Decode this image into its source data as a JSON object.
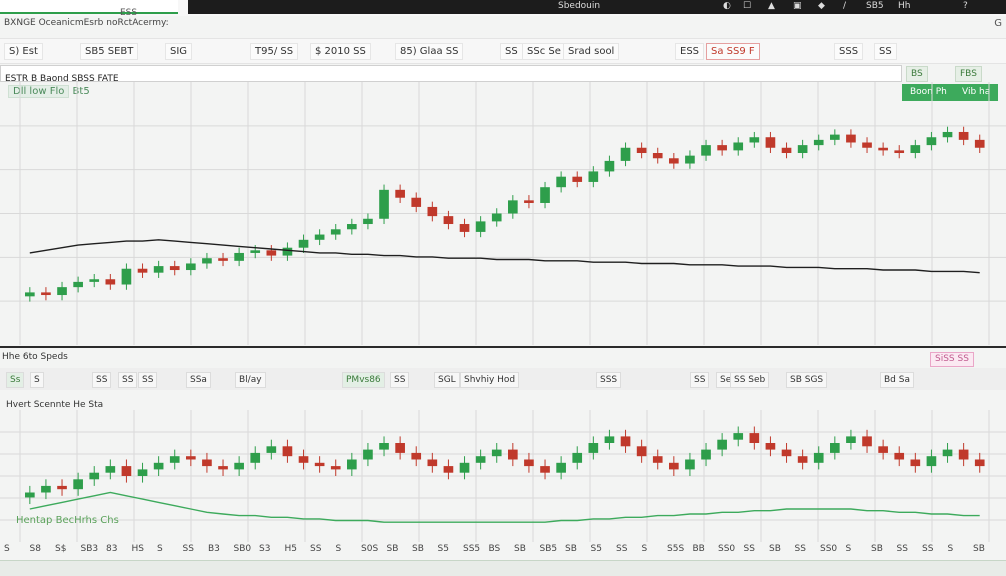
{
  "topbar": {
    "tab_label": "ESS",
    "dark_text": "Sbedouin",
    "right_items": [
      "◐",
      "☐",
      "▲",
      "▣",
      "◆",
      "/",
      "SB5",
      "Hh",
      "?"
    ]
  },
  "title_line": "BXNGE OceanicmEsrb noRctAcermy:",
  "right_corner": "G",
  "toolbar": {
    "items": [
      {
        "label": "S) Est"
      },
      {
        "label": "SB5 SEBT"
      },
      {
        "label": "SIG"
      },
      {
        "label": "T95/ SS"
      },
      {
        "label": "$ 2010 SS"
      },
      {
        "label": "85) Glaa  SS"
      },
      {
        "label": "SS"
      },
      {
        "label": "SSc Se"
      },
      {
        "label": "Srad sool"
      },
      {
        "label": "ESS"
      },
      {
        "label": "Sa  SS9 F"
      },
      {
        "label": "SSS"
      },
      {
        "label": "SS"
      }
    ]
  },
  "symbol_bar": "ESTR B  Baond  SBSS FATE",
  "sym_buttons": [
    "BS",
    "FBS"
  ],
  "subhead": {
    "box": "Dll low  Flo",
    "text": "Bt5"
  },
  "green_buttons": [
    "Boon Ph",
    "Vib ha"
  ],
  "lower_label": "Hhe 6to Speds",
  "lower_right_btn": "SiSS SS",
  "toolbar2": {
    "items": [
      {
        "label": "Ss"
      },
      {
        "label": "S"
      },
      {
        "label": "SS"
      },
      {
        "label": "SS"
      },
      {
        "label": "SS"
      },
      {
        "label": "SSa"
      },
      {
        "label": "Bl/ay"
      },
      {
        "label": "PMvs86"
      },
      {
        "label": "SS"
      },
      {
        "label": "SGL"
      },
      {
        "label": "Shvhiy  Hod"
      },
      {
        "label": "SSS"
      },
      {
        "label": "SS"
      },
      {
        "label": "Se"
      },
      {
        "label": "SS  Seb"
      },
      {
        "label": "SB  SGS"
      },
      {
        "label": "Bd  Sa"
      }
    ]
  },
  "panel2_title": "Hvert Scennte  He Sta",
  "panel2_legend": "Hentap BecHrhs  Chs",
  "colors": {
    "up": "#2e9e4b",
    "down": "#c0392b",
    "ma": "#1f1f1f",
    "accent": "#3daa5c",
    "grid": "#d9d9d9"
  },
  "chart_data": [
    {
      "type": "candlestick",
      "grid": true,
      "x_axis_labels": [],
      "candles_up_down_pattern": "mixed",
      "close_series": [
        40,
        38,
        44,
        48,
        50,
        46,
        58,
        55,
        60,
        57,
        62,
        66,
        64,
        70,
        72,
        68,
        74,
        80,
        84,
        88,
        92,
        96,
        118,
        112,
        105,
        98,
        92,
        86,
        94,
        100,
        110,
        108,
        120,
        128,
        124,
        132,
        140,
        150,
        146,
        142,
        138,
        144,
        152,
        148,
        154,
        158,
        150,
        146,
        152,
        156,
        160,
        154,
        150,
        148,
        146,
        152,
        158,
        162,
        156,
        150
      ],
      "moving_average": [
        70,
        72,
        74,
        76,
        77,
        78,
        79,
        79,
        80,
        79,
        78,
        77,
        76,
        75,
        74,
        73,
        72,
        71,
        70,
        70,
        69,
        69,
        68,
        68,
        67,
        67,
        66,
        66,
        66,
        65,
        65,
        65,
        64,
        64,
        64,
        63,
        63,
        63,
        62,
        62,
        62,
        61,
        61,
        61,
        60,
        60,
        60,
        59,
        59,
        59,
        58,
        58,
        58,
        57,
        57,
        57,
        56,
        56,
        56,
        55
      ]
    },
    {
      "type": "candlestick",
      "grid": true,
      "close_series": [
        30,
        34,
        32,
        38,
        42,
        46,
        40,
        44,
        48,
        52,
        50,
        46,
        44,
        48,
        54,
        58,
        52,
        48,
        46,
        44,
        50,
        56,
        60,
        54,
        50,
        46,
        42,
        48,
        52,
        56,
        50,
        46,
        42,
        48,
        54,
        60,
        64,
        58,
        52,
        48,
        44,
        50,
        56,
        62,
        66,
        60,
        56,
        52,
        48,
        54,
        60,
        64,
        58,
        54,
        50,
        46,
        52,
        56,
        50,
        46
      ],
      "moving_average": [
        20,
        22,
        24,
        26,
        28,
        30,
        28,
        26,
        24,
        22,
        20,
        18,
        17,
        16,
        16,
        15,
        15,
        14,
        14,
        13,
        13,
        13,
        12,
        12,
        12,
        12,
        12,
        12,
        12,
        12,
        12,
        12,
        12,
        13,
        13,
        14,
        14,
        15,
        15,
        16,
        16,
        17,
        17,
        18,
        18,
        19,
        19,
        20,
        20,
        20,
        20,
        20,
        19,
        19,
        18,
        18,
        17,
        17,
        16,
        16
      ]
    }
  ]
}
